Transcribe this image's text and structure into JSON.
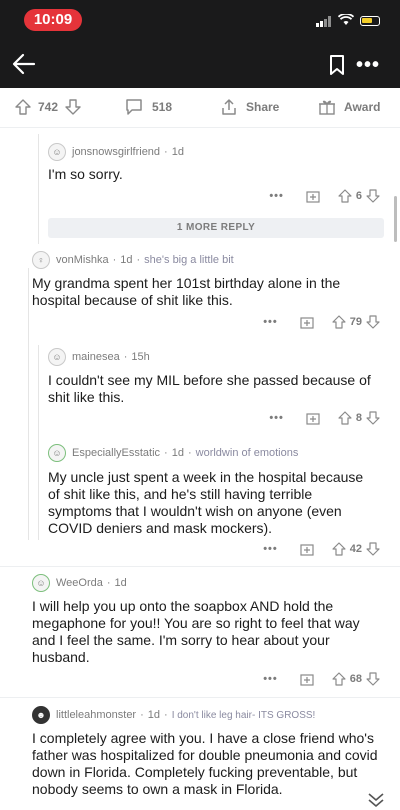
{
  "status_bar": {
    "time": "10:09"
  },
  "post_bar": {
    "vote_count": "742",
    "comment_count": "518",
    "share_label": "Share",
    "award_label": "Award"
  },
  "comments": [
    {
      "author": "jonsnowsgirlfriend",
      "age": "1d",
      "flair": "",
      "text": "I'm so sorry.",
      "score": "6"
    },
    {
      "author": "vonMishka",
      "age": "1d",
      "flair": "she's big a little bit",
      "text": "My grandma spent her 101st birthday alone in the hospital because of shit like this.",
      "score": "79"
    },
    {
      "author": "mainesea",
      "age": "15h",
      "flair": "",
      "text": "I couldn't see my MIL before she passed because of shit like this.",
      "score": "8"
    },
    {
      "author": "EspeciallyEsstatic",
      "age": "1d",
      "flair": "worldwin of emotions",
      "text": "My uncle just spent a week in the hospital because of shit like this, and he's still having terrible symptoms that I wouldn't wish on anyone (even COVID deniers and mask mockers).",
      "score": "42"
    },
    {
      "author": "WeeOrda",
      "age": "1d",
      "flair": "",
      "text": "I will help you up onto the soapbox AND hold the megaphone for you!!  You are so right to feel that way and I feel the same.  I'm sorry to hear about your husband.",
      "score": "68"
    },
    {
      "author": "littleleahmonster",
      "age": "1d",
      "flair": "I don't like leg hair- ITS GROSS!",
      "text": "I completely agree with you. I have a close friend who's father was hospitalized for double pneumonia and covid down in Florida. Completely fucking preventable, but nobody seems to own a mask in Florida.",
      "score": ""
    }
  ],
  "more_replies_label": "1 MORE REPLY",
  "more_actions_symbol": "•••",
  "meta_separator": "·"
}
